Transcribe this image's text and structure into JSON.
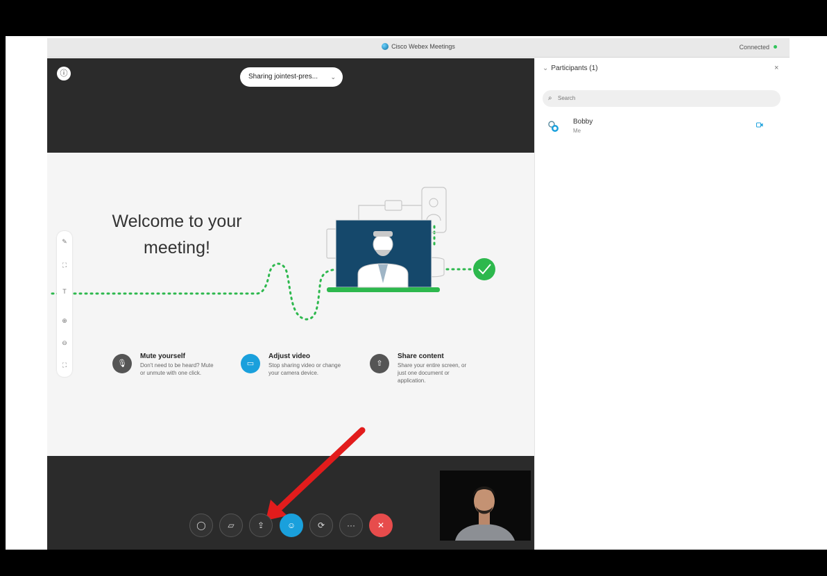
{
  "window": {
    "title": "Cisco Webex Meetings",
    "status": "Connected"
  },
  "meeting": {
    "sharing_label": "Sharing jointest-pres...",
    "slide": {
      "headline_line1": "Welcome to your",
      "headline_line2": "meeting!",
      "features": [
        {
          "title": "Mute yourself",
          "desc": "Don't need to be heard? Mute or unmute with one click.",
          "icon": "microphone-icon",
          "color": "#555555"
        },
        {
          "title": "Adjust video",
          "desc": "Stop sharing video or change your camera device.",
          "icon": "video-icon",
          "color": "#1aa0dc"
        },
        {
          "title": "Share content",
          "desc": "Share your entire screen, or just one document or application.",
          "icon": "share-icon",
          "color": "#555555"
        }
      ]
    },
    "controls": [
      "mute-icon",
      "video-icon",
      "share-icon",
      "participants-icon",
      "switch-icon",
      "more-icon",
      "end-call-icon"
    ]
  },
  "participants": {
    "header": "Participants (1)",
    "search_placeholder": "Search",
    "list": [
      {
        "name": "Bobby",
        "role": "Me"
      }
    ]
  },
  "colors": {
    "accent": "#1aa0dc",
    "end_call": "#e74c4c",
    "status_ok": "#30c45a",
    "dotted_path": "#2db84d",
    "annotation_arrow": "#e21c1c"
  }
}
